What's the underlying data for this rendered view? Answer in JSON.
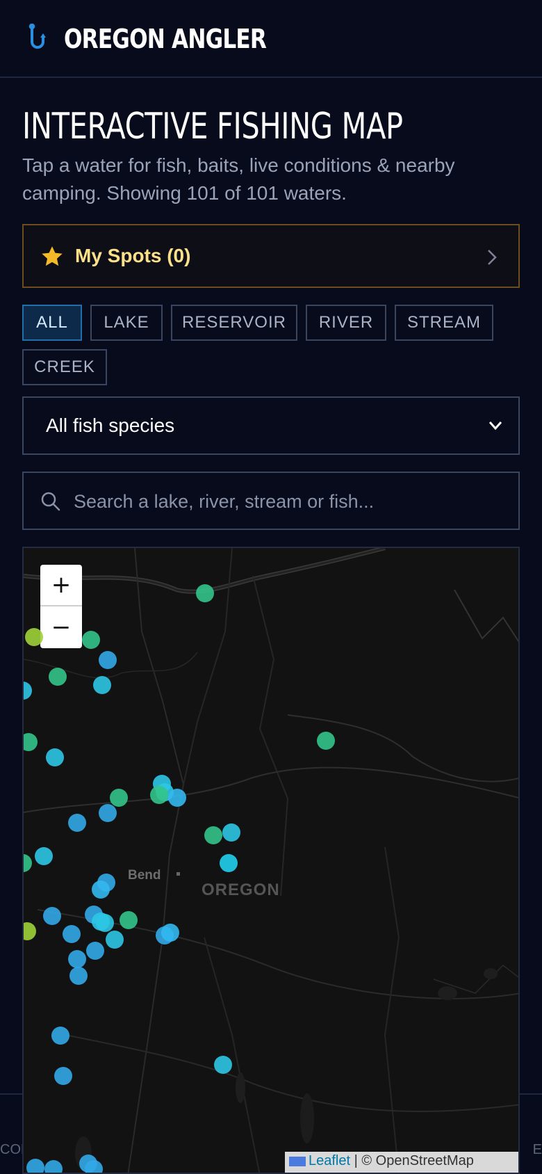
{
  "header": {
    "brand": "OREGON ANGLER",
    "logo_icon": "fishing-hook-icon",
    "accent": "#2b8fe0"
  },
  "page": {
    "title": "INTERACTIVE FISHING MAP",
    "subtitle": "Tap a water for fish, baits, live conditions & nearby camping. Showing 101 of 101 waters."
  },
  "my_spots": {
    "label": "My Spots (0)",
    "icon": "star-icon",
    "color": "#f5b92a"
  },
  "filters": {
    "chips": [
      {
        "label": "ALL",
        "active": true
      },
      {
        "label": "LAKE",
        "active": false
      },
      {
        "label": "RESERVOIR",
        "active": false
      },
      {
        "label": "RIVER",
        "active": false
      },
      {
        "label": "STREAM",
        "active": false
      },
      {
        "label": "CREEK",
        "active": false
      }
    ]
  },
  "species_select": {
    "value": "All fish species"
  },
  "search": {
    "placeholder": "Search a lake, river, stream or fish..."
  },
  "map": {
    "zoom_in": "+",
    "zoom_out": "−",
    "places": {
      "city": "Bend",
      "state": "OREGON"
    },
    "attribution": {
      "leaflet": "Leaflet",
      "separator": " | ",
      "osm": "© OpenStreetMap"
    },
    "marker_colors": {
      "lake": "#33b8f0",
      "reservoir": "#2ec7e6",
      "river": "#33c48a",
      "stream": "#9fd23a"
    }
  },
  "footer": {
    "left": "CON",
    "right": "E"
  }
}
